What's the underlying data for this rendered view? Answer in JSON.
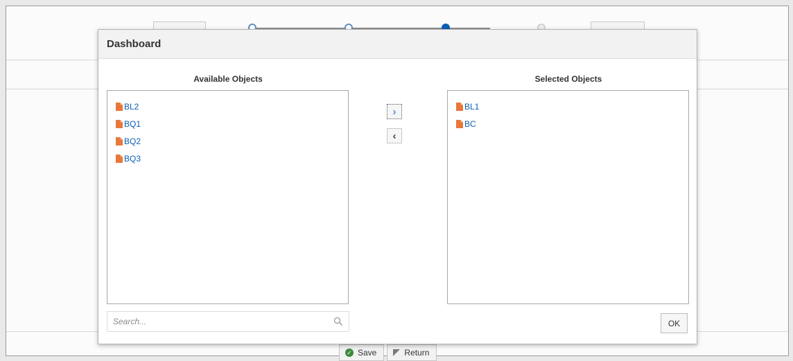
{
  "dialog": {
    "title": "Dashboard",
    "available": {
      "header": "Available Objects",
      "items": [
        "BL2",
        "BQ1",
        "BQ2",
        "BQ3"
      ]
    },
    "selected": {
      "header": "Selected Objects",
      "items": [
        "BL1",
        "BC"
      ]
    },
    "move_glyph": "›",
    "remove_glyph": "‹",
    "search_placeholder": "Search...",
    "ok_label": "OK",
    "item_icon": "document-icon"
  },
  "page": {
    "save_label": "Save",
    "return_label": "Return"
  },
  "colors": {
    "link": "#0a5fb4",
    "doc_icon": "#e8773a",
    "accent": "#4a90d9"
  }
}
